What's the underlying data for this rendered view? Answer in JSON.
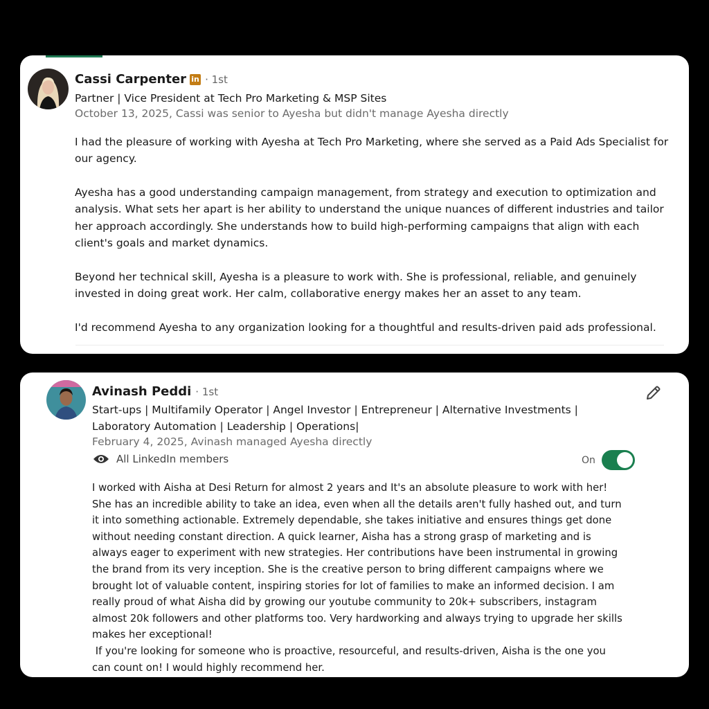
{
  "recommendations": [
    {
      "name": "Cassi Carpenter",
      "linkedin_badge": "in",
      "degree": "· 1st",
      "headline": "Partner | Vice President at Tech Pro Marketing & MSP Sites",
      "meta": "October 13, 2025, Cassi was senior to Ayesha but didn't manage Ayesha directly",
      "paragraphs": [
        "I had the pleasure of working with Ayesha at Tech Pro Marketing, where she served as a Paid Ads Specialist for our agency.",
        "Ayesha has a good understanding campaign management, from strategy and execution to optimization and analysis. What sets her apart is her ability to understand the unique nuances of different industries and tailor her approach accordingly. She understands how to build high-performing campaigns that align with each client's goals and market dynamics.",
        "Beyond her technical skill, Ayesha is a pleasure to work with. She is professional, reliable, and genuinely invested in doing great work. Her calm, collaborative energy makes her an asset to any team.",
        "I'd recommend Ayesha to any organization looking for a thoughtful and results-driven paid ads professional."
      ]
    },
    {
      "name": "Avinash Peddi",
      "degree": "· 1st",
      "headline": "Start-ups | Multifamily Operator | Angel Investor | Entrepreneur | Alternative Investments | Laboratory Automation | Leadership | Operations|",
      "meta": "February 4, 2025, Avinash managed Ayesha directly",
      "visibility": "All LinkedIn members",
      "toggle_label": "On",
      "toggle_on": true,
      "paragraphs": [
        "I worked with Aisha at Desi Return for almost 2 years and It's an absolute pleasure to work with her! She has an incredible ability to take an idea, even when all the details aren't fully hashed out, and turn it into something actionable. Extremely dependable, she takes initiative and ensures things get done without needing constant direction. A quick learner, Aisha has a strong grasp of marketing and is always eager to experiment with new strategies. Her contributions have been instrumental in growing the brand from its very inception. She is the creative person to bring different campaigns where we brought lot of valuable content, inspiring stories for lot of families to make an informed decision. I am really proud of what Aisha did by growing our youtube community to 20k+ subscribers, instagram almost 20k followers and other platforms too. Very hardworking and always trying to upgrade her skills makes her exceptional!",
        " If you're looking for someone who is proactive, resourceful, and results-driven, Aisha is the one you can count on! I would highly recommend her."
      ]
    }
  ],
  "icons": {
    "edit": "pencil-icon",
    "visibility": "eye-icon"
  },
  "colors": {
    "accent_green": "#1a7f4f",
    "linkedin_badge": "#c37d16",
    "background": "#000000",
    "card": "#ffffff"
  }
}
